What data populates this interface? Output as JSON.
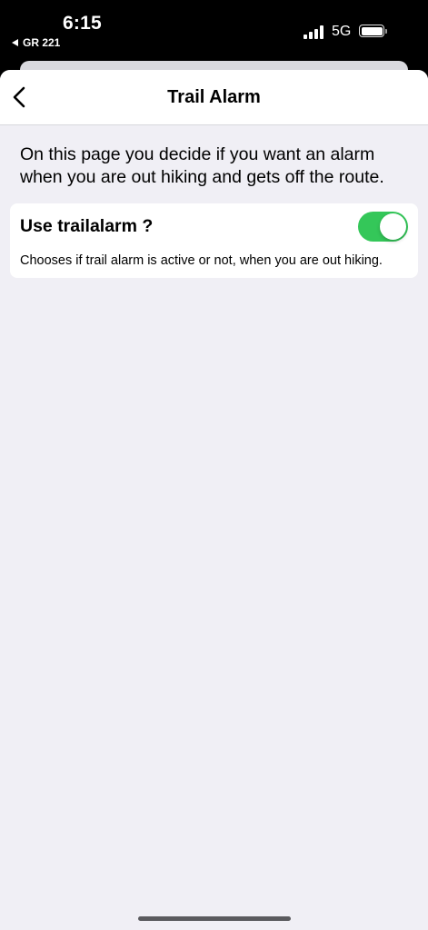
{
  "status_bar": {
    "time": "6:15",
    "back_app": "GR 221",
    "network": "5G",
    "signal_bars": 4,
    "battery_level": 1.0
  },
  "nav": {
    "title": "Trail Alarm",
    "back_icon": "chevron-left-icon"
  },
  "intro": "On this page you decide if you want an alarm when you are out hiking and gets off the route.",
  "setting": {
    "label": "Use trailalarm ?",
    "description": "Chooses if trail alarm is active or not, when you are out hiking.",
    "enabled": true
  },
  "colors": {
    "toggle_on": "#34c759",
    "background": "#f0eff5",
    "card": "#ffffff"
  }
}
